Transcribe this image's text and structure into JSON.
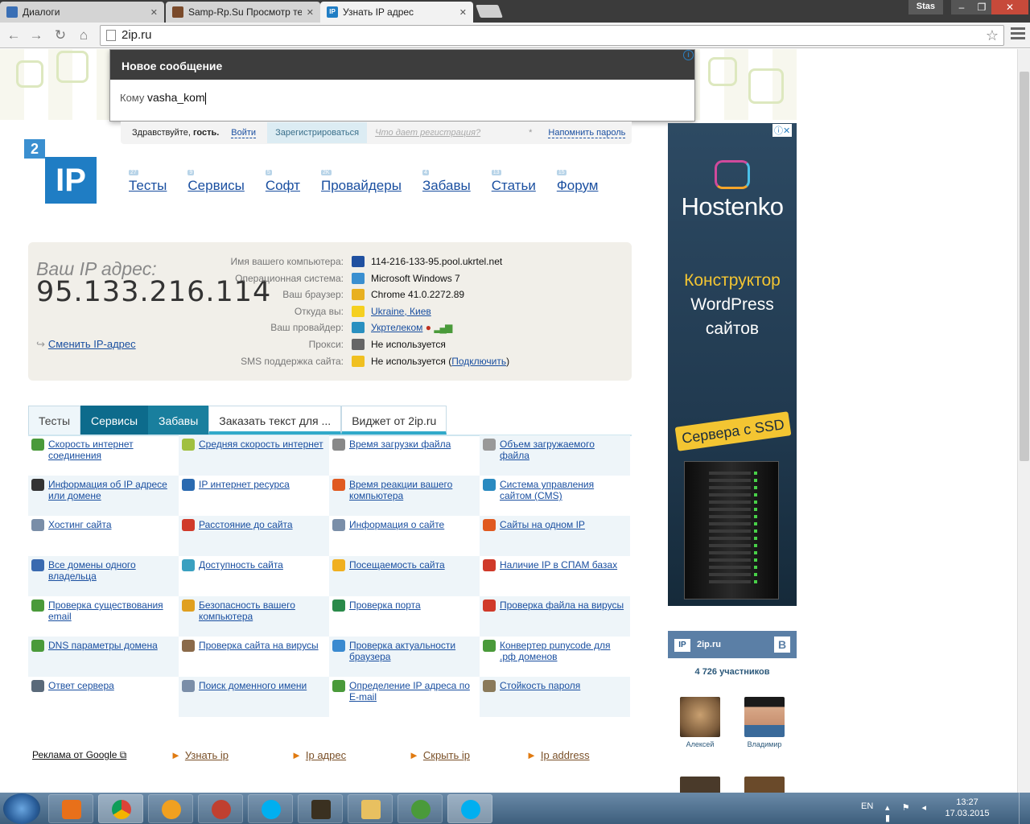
{
  "browser": {
    "tabs": [
      {
        "label": "Диалоги",
        "color": "#3a6fb5"
      },
      {
        "label": "Samp-Rp.Su Просмотр те",
        "color": "#7a4a2a"
      },
      {
        "label": "Узнать IP адрес",
        "color": "#1f7dc4"
      }
    ],
    "user": "Stas",
    "url": "2ip.ru"
  },
  "popup": {
    "title": "Новое сообщение",
    "to_label": "Кому",
    "to_value": "vasha_kom"
  },
  "login_bar": {
    "greeting_prefix": "Здравствуйте, ",
    "greeting_name": "гость.",
    "login": "Войти",
    "register": "Зарегистрироваться",
    "register_hint": "Что дает регистрация?",
    "remind_star": "*",
    "remind": "Напомнить пароль"
  },
  "logo": {
    "small": "2",
    "big": "IP"
  },
  "nav": [
    {
      "label": "Тесты",
      "count": "27"
    },
    {
      "label": "Сервисы",
      "count": "9"
    },
    {
      "label": "Софт",
      "count": "5"
    },
    {
      "label": "Провайдеры",
      "count": "2K"
    },
    {
      "label": "Забавы",
      "count": "4"
    },
    {
      "label": "Статьи",
      "count": "13"
    },
    {
      "label": "Форум",
      "count": "15"
    }
  ],
  "ip": {
    "label": "Ваш IP адрес:",
    "value": "95.133.216.114",
    "change": "Сменить IP-адрес",
    "rows": [
      {
        "k": "Имя вашего компьютера:",
        "v": "114-216-133-95.pool.ukrtel.net",
        "icon": "computer-icon",
        "c": "#2050a0",
        "link": false
      },
      {
        "k": "Операционная система:",
        "v": "Microsoft Windows 7",
        "icon": "windows-icon",
        "c": "#3a8fd0",
        "link": false
      },
      {
        "k": "Ваш браузер:",
        "v": "Chrome 41.0.2272.89",
        "icon": "chrome-icon",
        "c": "#e8b020",
        "link": false
      },
      {
        "k": "Откуда вы:",
        "v": "Ukraine, Киев",
        "icon": "ukraine-flag-icon",
        "c": "#f5d020",
        "link": true
      },
      {
        "k": "Ваш провайдер:",
        "v": "Укртелеком",
        "icon": "provider-icon",
        "c": "#2a90c0",
        "link": true
      },
      {
        "k": "Прокси:",
        "v": "Не используется",
        "icon": "glasses-icon",
        "c": "#666666",
        "link": false
      },
      {
        "k": "SMS поддержка сайта:",
        "v": "Не используется (",
        "v_link": "Подключить",
        "v_end": ")",
        "icon": "warning-icon",
        "c": "#f0c020",
        "link": false
      }
    ]
  },
  "section_tabs": [
    "Тесты",
    "Сервисы",
    "Забавы",
    "Заказать текст для ...",
    "Виджет от 2ip.ru"
  ],
  "services": [
    {
      "label": "Скорость интернет соединения",
      "c": "#4a9a3a"
    },
    {
      "label": "Средняя скорость интернет",
      "c": "#a0c040"
    },
    {
      "label": "Время загрузки файла",
      "c": "#888888"
    },
    {
      "label": "Объем загружаемого файла",
      "c": "#999999"
    },
    {
      "label": "Информация об IP адресе или домене",
      "c": "#333333"
    },
    {
      "label": "IP интернет ресурса",
      "c": "#2a6ab0"
    },
    {
      "label": "Время реакции вашего компьютера",
      "c": "#e05a20"
    },
    {
      "label": "Система управления сайтом (CMS)",
      "c": "#2a8ac0"
    },
    {
      "label": "Хостинг сайта",
      "c": "#7a8ea8"
    },
    {
      "label": "Расстояние до сайта",
      "c": "#d03a2a"
    },
    {
      "label": "Информация о сайте",
      "c": "#7a8ea8"
    },
    {
      "label": "Сайты на одном IP",
      "c": "#e05a20"
    },
    {
      "label": "Все домены одного владельца",
      "c": "#3a6ab0"
    },
    {
      "label": "Доступность сайта",
      "c": "#3aa0c0"
    },
    {
      "label": "Посещаемость сайта",
      "c": "#f0b020"
    },
    {
      "label": "Наличие IP в СПАМ базах",
      "c": "#d03a2a"
    },
    {
      "label": "Проверка существования email",
      "c": "#4a9a3a"
    },
    {
      "label": "Безопасность вашего компьютера",
      "c": "#e0a020"
    },
    {
      "label": "Проверка порта",
      "c": "#2a8a4a"
    },
    {
      "label": "Проверка файла на вирусы",
      "c": "#d03a2a"
    },
    {
      "label": "DNS параметры домена",
      "c": "#4a9a3a"
    },
    {
      "label": "Проверка сайта на вирусы",
      "c": "#8a6a4a"
    },
    {
      "label": "Проверка актуальности браузера",
      "c": "#3a8ad0"
    },
    {
      "label": "Конвертер punycode для .рф доменов",
      "c": "#4a9a3a"
    },
    {
      "label": "Ответ сервера",
      "c": "#5a6a7a"
    },
    {
      "label": "Поиск доменного имени",
      "c": "#7a8ea8"
    },
    {
      "label": "Определение IP адреса по E-mail",
      "c": "#4a9a3a"
    },
    {
      "label": "Стойкость пароля",
      "c": "#8a7a5a"
    }
  ],
  "google_ads": {
    "title": "Реклама от Google",
    "links": [
      "Узнать ip",
      "Ip адрес",
      "Скрыть ip",
      "Ip address"
    ]
  },
  "banner": {
    "brand": "Hostenko",
    "line1": "Конструктор",
    "line2": "WordPress",
    "line3": "сайтов",
    "ssd": "Сервера с SSD"
  },
  "vk": {
    "name": "2ip.ru",
    "count": "4 726 участников",
    "members": [
      "Алексей",
      "Владимир"
    ]
  },
  "taskbar": {
    "lang": "EN",
    "time": "13:27",
    "date": "17.03.2015"
  }
}
